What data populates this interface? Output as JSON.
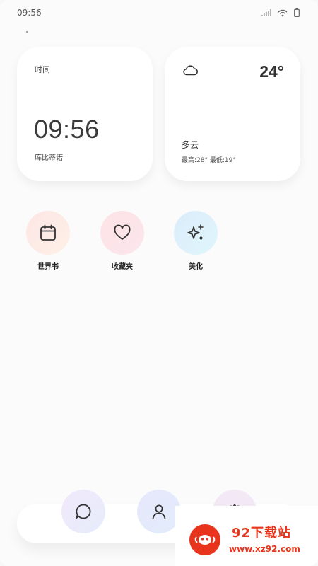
{
  "status": {
    "time": "09:56"
  },
  "time_card": {
    "label": "时间",
    "time": "09:56",
    "subtitle": "库比蒂诺"
  },
  "weather_card": {
    "icon": "cloud-icon",
    "temperature": "24°",
    "condition": "多云",
    "range": "最高:28° 最低:19°"
  },
  "shortcuts": [
    {
      "name": "世界书",
      "icon": "calendar-icon"
    },
    {
      "name": "收藏夹",
      "icon": "heart-icon"
    },
    {
      "name": "美化",
      "icon": "sparkles-icon"
    }
  ],
  "dock": [
    {
      "icon": "chat-bubble-icon"
    },
    {
      "icon": "user-icon"
    },
    {
      "icon": "settings-icon"
    }
  ],
  "watermark": {
    "title": "92下载站",
    "url": "www.xz92.com"
  },
  "colors": {
    "brand_red": "#e8341c",
    "card_bg": "#ffffff",
    "page_bg": "#fbfbfc"
  }
}
